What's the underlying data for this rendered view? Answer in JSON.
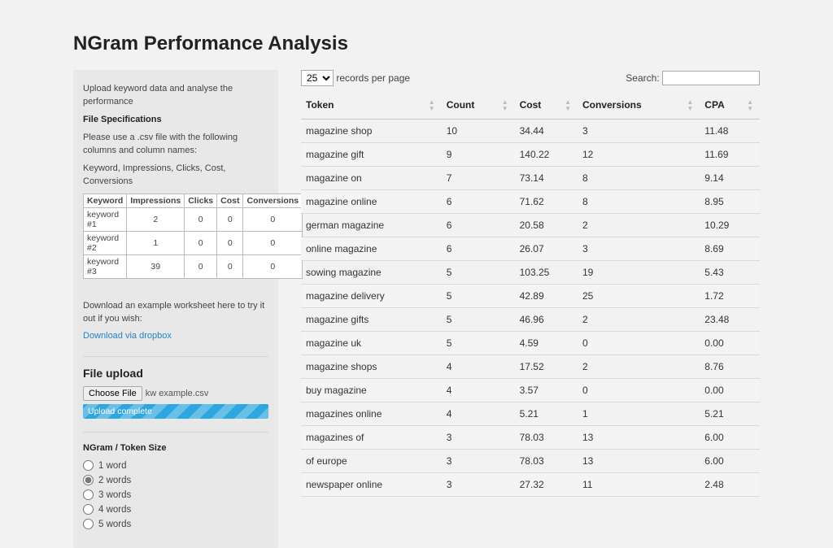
{
  "title": "NGram Performance Analysis",
  "sidebar": {
    "intro": "Upload keyword data and analyse the performance",
    "spec_heading": "File Specifications",
    "spec_text": "Please use a .csv file with the following columns and column names:",
    "spec_cols": "Keyword, Impressions, Clicks, Cost, Conversions",
    "download_prompt": "Download an example worksheet here to try it out if you wish:",
    "download_link": "Download via dropbox",
    "example": {
      "headers": [
        "Keyword",
        "Impressions",
        "Clicks",
        "Cost",
        "Conversions"
      ],
      "rows": [
        {
          "c0": "keyword #1",
          "c1": "2",
          "c2": "0",
          "c3": "0",
          "c4": "0"
        },
        {
          "c0": "keyword #2",
          "c1": "1",
          "c2": "0",
          "c3": "0",
          "c4": "0"
        },
        {
          "c0": "keyword #3",
          "c1": "39",
          "c2": "0",
          "c3": "0",
          "c4": "0"
        }
      ]
    },
    "upload_heading": "File upload",
    "choose_file_label": "Choose File",
    "file_name": "kw example.csv",
    "upload_status": "Upload complete",
    "ngram_heading": "NGram / Token Size",
    "ngram_options": [
      "1 word",
      "2 words",
      "3 words",
      "4 words",
      "5 words"
    ],
    "ngram_selected": "2 words"
  },
  "controls": {
    "page_size": "25",
    "page_size_suffix": "records per page",
    "search_label": "Search:",
    "search_value": ""
  },
  "table": {
    "columns": [
      "Token",
      "Count",
      "Cost",
      "Conversions",
      "CPA"
    ],
    "rows": [
      {
        "c0": "magazine shop",
        "c1": "10",
        "c2": "34.44",
        "c3": "3",
        "c4": "11.48"
      },
      {
        "c0": "magazine gift",
        "c1": "9",
        "c2": "140.22",
        "c3": "12",
        "c4": "11.69"
      },
      {
        "c0": "magazine on",
        "c1": "7",
        "c2": "73.14",
        "c3": "8",
        "c4": "9.14"
      },
      {
        "c0": "magazine online",
        "c1": "6",
        "c2": "71.62",
        "c3": "8",
        "c4": "8.95"
      },
      {
        "c0": "german magazine",
        "c1": "6",
        "c2": "20.58",
        "c3": "2",
        "c4": "10.29"
      },
      {
        "c0": "online magazine",
        "c1": "6",
        "c2": "26.07",
        "c3": "3",
        "c4": "8.69"
      },
      {
        "c0": "sowing magazine",
        "c1": "5",
        "c2": "103.25",
        "c3": "19",
        "c4": "5.43"
      },
      {
        "c0": "magazine delivery",
        "c1": "5",
        "c2": "42.89",
        "c3": "25",
        "c4": "1.72"
      },
      {
        "c0": "magazine gifts",
        "c1": "5",
        "c2": "46.96",
        "c3": "2",
        "c4": "23.48"
      },
      {
        "c0": "magazine uk",
        "c1": "5",
        "c2": "4.59",
        "c3": "0",
        "c4": "0.00"
      },
      {
        "c0": "magazine shops",
        "c1": "4",
        "c2": "17.52",
        "c3": "2",
        "c4": "8.76"
      },
      {
        "c0": "buy magazine",
        "c1": "4",
        "c2": "3.57",
        "c3": "0",
        "c4": "0.00"
      },
      {
        "c0": "magazines online",
        "c1": "4",
        "c2": "5.21",
        "c3": "1",
        "c4": "5.21"
      },
      {
        "c0": "magazines of",
        "c1": "3",
        "c2": "78.03",
        "c3": "13",
        "c4": "6.00"
      },
      {
        "c0": "of europe",
        "c1": "3",
        "c2": "78.03",
        "c3": "13",
        "c4": "6.00"
      },
      {
        "c0": "newspaper online",
        "c1": "3",
        "c2": "27.32",
        "c3": "11",
        "c4": "2.48"
      }
    ]
  }
}
